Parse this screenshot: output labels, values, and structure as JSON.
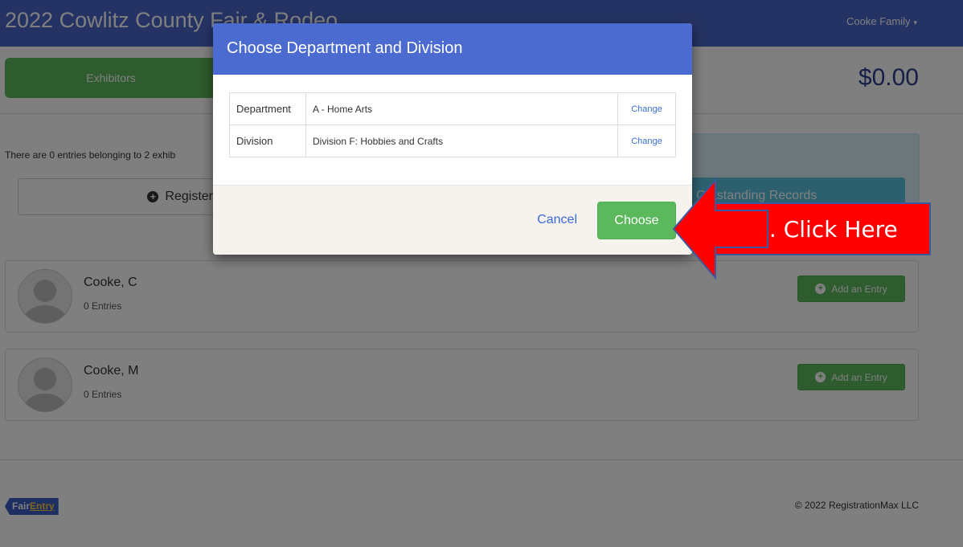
{
  "header": {
    "title": "2022 Cowlitz County Fair & Rodeo",
    "user_menu": "Cooke Family",
    "caret": "▾"
  },
  "tabs": {
    "exhibitors": "Exhibitors"
  },
  "cart_total": "$0.00",
  "summary": {
    "text": "There are 0 entries belonging to 2 exhib",
    "register_label": "Register",
    "outstanding_label": "Outstanding Records"
  },
  "exhibitors": [
    {
      "name": "Cooke, C",
      "entries": "0 Entries",
      "add_label": "Add an Entry"
    },
    {
      "name": "Cooke, M",
      "entries": "0 Entries",
      "add_label": "Add an Entry"
    }
  ],
  "footer": {
    "logo_part1": "Fair",
    "logo_part2": "Entry",
    "copyright": "© 2022 RegistrationMax LLC"
  },
  "modal": {
    "title": "Choose Department and Division",
    "rows": [
      {
        "key": "Department",
        "value": "A - Home Arts",
        "action": "Change"
      },
      {
        "key": "Division",
        "value": "Division F: Hobbies and Crafts",
        "action": "Change"
      }
    ],
    "cancel_label": "Cancel",
    "choose_label": "Choose"
  },
  "annotation": {
    "text": "24. Click Here",
    "color": "#ff0000"
  },
  "icons": {
    "plus": "plus-circle-icon",
    "avatar": "user-avatar-icon",
    "arrow": "red-arrow-icon"
  }
}
